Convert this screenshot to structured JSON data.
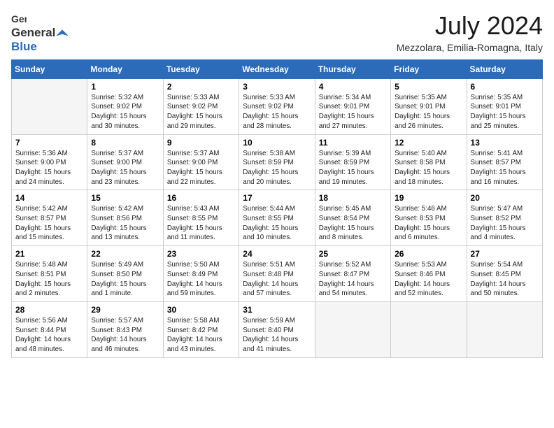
{
  "logo": {
    "general": "General",
    "blue": "Blue"
  },
  "title": "July 2024",
  "location": "Mezzolara, Emilia-Romagna, Italy",
  "days_of_week": [
    "Sunday",
    "Monday",
    "Tuesday",
    "Wednesday",
    "Thursday",
    "Friday",
    "Saturday"
  ],
  "weeks": [
    [
      {
        "day": "",
        "empty": true
      },
      {
        "day": "1",
        "sunrise": "5:32 AM",
        "sunset": "9:02 PM",
        "daylight": "15 hours and 30 minutes."
      },
      {
        "day": "2",
        "sunrise": "5:33 AM",
        "sunset": "9:02 PM",
        "daylight": "15 hours and 29 minutes."
      },
      {
        "day": "3",
        "sunrise": "5:33 AM",
        "sunset": "9:02 PM",
        "daylight": "15 hours and 28 minutes."
      },
      {
        "day": "4",
        "sunrise": "5:34 AM",
        "sunset": "9:01 PM",
        "daylight": "15 hours and 27 minutes."
      },
      {
        "day": "5",
        "sunrise": "5:35 AM",
        "sunset": "9:01 PM",
        "daylight": "15 hours and 26 minutes."
      },
      {
        "day": "6",
        "sunrise": "5:35 AM",
        "sunset": "9:01 PM",
        "daylight": "15 hours and 25 minutes."
      }
    ],
    [
      {
        "day": "7",
        "sunrise": "5:36 AM",
        "sunset": "9:00 PM",
        "daylight": "15 hours and 24 minutes."
      },
      {
        "day": "8",
        "sunrise": "5:37 AM",
        "sunset": "9:00 PM",
        "daylight": "15 hours and 23 minutes."
      },
      {
        "day": "9",
        "sunrise": "5:37 AM",
        "sunset": "9:00 PM",
        "daylight": "15 hours and 22 minutes."
      },
      {
        "day": "10",
        "sunrise": "5:38 AM",
        "sunset": "8:59 PM",
        "daylight": "15 hours and 20 minutes."
      },
      {
        "day": "11",
        "sunrise": "5:39 AM",
        "sunset": "8:59 PM",
        "daylight": "15 hours and 19 minutes."
      },
      {
        "day": "12",
        "sunrise": "5:40 AM",
        "sunset": "8:58 PM",
        "daylight": "15 hours and 18 minutes."
      },
      {
        "day": "13",
        "sunrise": "5:41 AM",
        "sunset": "8:57 PM",
        "daylight": "15 hours and 16 minutes."
      }
    ],
    [
      {
        "day": "14",
        "sunrise": "5:42 AM",
        "sunset": "8:57 PM",
        "daylight": "15 hours and 15 minutes."
      },
      {
        "day": "15",
        "sunrise": "5:42 AM",
        "sunset": "8:56 PM",
        "daylight": "15 hours and 13 minutes."
      },
      {
        "day": "16",
        "sunrise": "5:43 AM",
        "sunset": "8:55 PM",
        "daylight": "15 hours and 11 minutes."
      },
      {
        "day": "17",
        "sunrise": "5:44 AM",
        "sunset": "8:55 PM",
        "daylight": "15 hours and 10 minutes."
      },
      {
        "day": "18",
        "sunrise": "5:45 AM",
        "sunset": "8:54 PM",
        "daylight": "15 hours and 8 minutes."
      },
      {
        "day": "19",
        "sunrise": "5:46 AM",
        "sunset": "8:53 PM",
        "daylight": "15 hours and 6 minutes."
      },
      {
        "day": "20",
        "sunrise": "5:47 AM",
        "sunset": "8:52 PM",
        "daylight": "15 hours and 4 minutes."
      }
    ],
    [
      {
        "day": "21",
        "sunrise": "5:48 AM",
        "sunset": "8:51 PM",
        "daylight": "15 hours and 2 minutes."
      },
      {
        "day": "22",
        "sunrise": "5:49 AM",
        "sunset": "8:50 PM",
        "daylight": "15 hours and 1 minute."
      },
      {
        "day": "23",
        "sunrise": "5:50 AM",
        "sunset": "8:49 PM",
        "daylight": "14 hours and 59 minutes."
      },
      {
        "day": "24",
        "sunrise": "5:51 AM",
        "sunset": "8:48 PM",
        "daylight": "14 hours and 57 minutes."
      },
      {
        "day": "25",
        "sunrise": "5:52 AM",
        "sunset": "8:47 PM",
        "daylight": "14 hours and 54 minutes."
      },
      {
        "day": "26",
        "sunrise": "5:53 AM",
        "sunset": "8:46 PM",
        "daylight": "14 hours and 52 minutes."
      },
      {
        "day": "27",
        "sunrise": "5:54 AM",
        "sunset": "8:45 PM",
        "daylight": "14 hours and 50 minutes."
      }
    ],
    [
      {
        "day": "28",
        "sunrise": "5:56 AM",
        "sunset": "8:44 PM",
        "daylight": "14 hours and 48 minutes."
      },
      {
        "day": "29",
        "sunrise": "5:57 AM",
        "sunset": "8:43 PM",
        "daylight": "14 hours and 46 minutes."
      },
      {
        "day": "30",
        "sunrise": "5:58 AM",
        "sunset": "8:42 PM",
        "daylight": "14 hours and 43 minutes."
      },
      {
        "day": "31",
        "sunrise": "5:59 AM",
        "sunset": "8:40 PM",
        "daylight": "14 hours and 41 minutes."
      },
      {
        "day": "",
        "empty": true
      },
      {
        "day": "",
        "empty": true
      },
      {
        "day": "",
        "empty": true
      }
    ]
  ]
}
